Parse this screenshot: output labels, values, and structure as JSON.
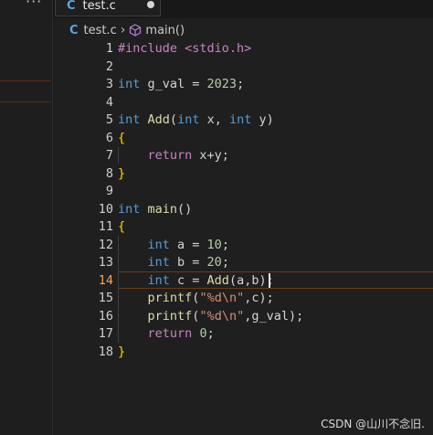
{
  "tab": {
    "label": "test.c",
    "icon": "c-language-icon"
  },
  "breadcrumb": {
    "file": "test.c",
    "symbol": "main()"
  },
  "editor": {
    "active_line": 14,
    "line_numbers": [
      "1",
      "2",
      "3",
      "4",
      "5",
      "6",
      "7",
      "8",
      "9",
      "10",
      "11",
      "12",
      "13",
      "14",
      "15",
      "16",
      "17",
      "18"
    ],
    "tokens": {
      "l1_include": "#include <stdio.h>",
      "l3_int": "int",
      "l3_rest": " g_val = ",
      "l3_num": "2023",
      "l3_end": ";",
      "l5_int": "int",
      "l5_sp": " ",
      "l5_fn": "Add",
      "l5_open": "(",
      "l5_int2": "int",
      "l5_x": " x, ",
      "l5_int3": "int",
      "l5_y": " y",
      "l5_close": ")",
      "l6_brace": "{",
      "l7_ret": "return",
      "l7_rest": " x+y;",
      "l8_brace": "}",
      "l10_int": "int",
      "l10_sp": " ",
      "l10_fn": "main",
      "l10_paren": "()",
      "l11_brace": "{",
      "l12_int": "int",
      "l12_rest": " a = ",
      "l12_num": "10",
      "l12_end": ";",
      "l13_int": "int",
      "l13_rest": " b = ",
      "l13_num": "20",
      "l13_end": ";",
      "l14_int": "int",
      "l14_rest": " c = ",
      "l14_fn": "Add",
      "l14_paren": "(a,b)",
      "l14_end": ";",
      "l15_fn": "printf",
      "l15_open": "(",
      "l15_str": "\"%d\\n\"",
      "l15_rest": ",c);",
      "l16_fn": "printf",
      "l16_open": "(",
      "l16_str": "\"%d\\n\"",
      "l16_rest": ",g_val);",
      "l17_ret": "return",
      "l17_sp": " ",
      "l17_num": "0",
      "l17_end": ";",
      "l18_brace": "}"
    }
  },
  "watermark": "CSDN @山川不念旧.",
  "colors": {
    "background": "#1f1f1f",
    "keyword": "#569cd6",
    "preprocessor": "#c586c0",
    "function": "#dcdcaa",
    "number": "#b5cea8",
    "string": "#ce9178",
    "bracket_level1": "#ffd700",
    "active_line_number": "#f0a45d"
  }
}
